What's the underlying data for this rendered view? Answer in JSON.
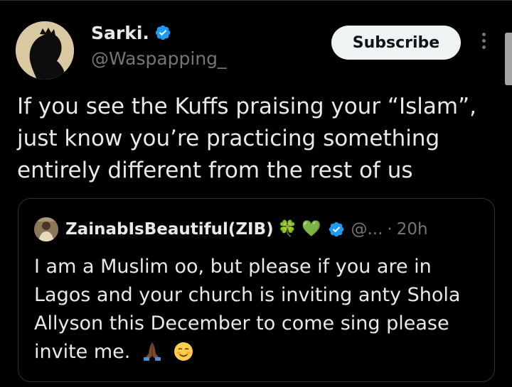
{
  "tweet": {
    "author": {
      "display_name": "Sarki.",
      "handle": "@Waspapping_",
      "verified": true
    },
    "subscribe_label": "Subscribe",
    "text_lines": [
      "If you see the Kuffs praising your “Islam”,",
      "just know you’re practicing something",
      "entirely different from the rest of us"
    ]
  },
  "quote": {
    "author": {
      "display_name": "ZainabIsBeautiful(ZIB)",
      "emojis": [
        "🍀",
        "💚"
      ],
      "verified": true,
      "handle": "@...",
      "separator": "·",
      "time": "20h"
    },
    "text_lines": [
      "I am a Muslim oo, but please if you are in",
      "Lagos and your church is inviting anty Shola",
      "Allyson this December to come sing please",
      "invite me."
    ],
    "trailing_emojis": [
      "🙏🏾",
      "☺️"
    ]
  },
  "icons": {
    "verified": "verified-badge-icon",
    "more": "more-vertical-icon"
  },
  "colors": {
    "background": "#000000",
    "text_primary": "#e7e9ea",
    "text_secondary": "#71767b",
    "border": "#2f3336",
    "verified_blue": "#1d9bf0",
    "button_bg": "#eff3f4"
  }
}
